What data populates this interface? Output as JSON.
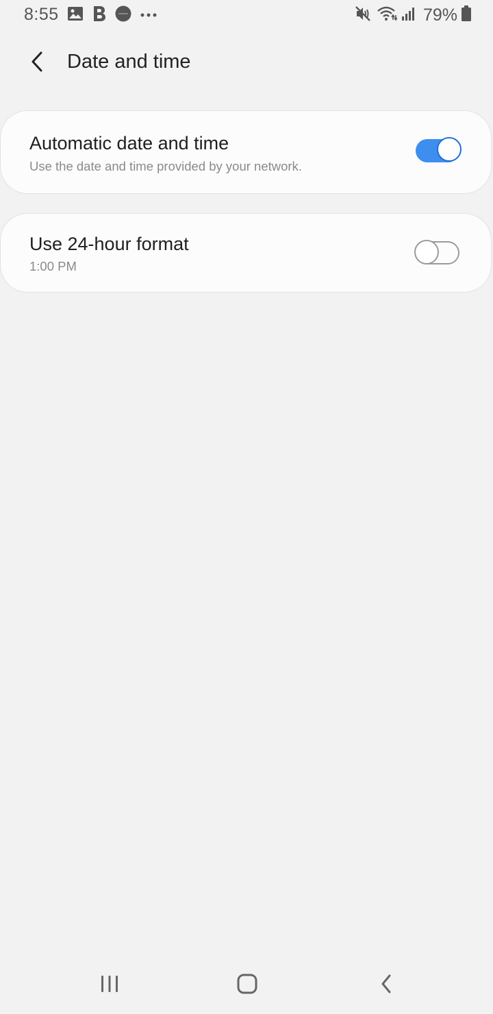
{
  "status_bar": {
    "time": "8:55",
    "battery_percent": "79%",
    "left_icons": [
      "gallery-icon",
      "b-app-icon",
      "app-badge-icon",
      "more-notifications-icon"
    ],
    "right_icons": [
      "mute-vibrate-icon",
      "wifi-icon",
      "signal-icon",
      "battery-icon"
    ]
  },
  "header": {
    "title": "Date and time",
    "back_icon": "chevron-left-icon"
  },
  "settings": [
    {
      "title": "Automatic date and time",
      "subtitle": "Use the date and time provided by your network.",
      "enabled": true
    },
    {
      "title": "Use 24-hour format",
      "subtitle": "1:00 PM",
      "enabled": false
    }
  ],
  "colors": {
    "background": "#f2f2f2",
    "card": "#fcfcfc",
    "toggle_on": "#3e8ef0",
    "toggle_on_knob_border": "#1c6fd6",
    "toggle_off": "#9a9a9a"
  },
  "nav_bar": {
    "icons": [
      "recents-icon",
      "home-icon",
      "back-icon"
    ]
  }
}
